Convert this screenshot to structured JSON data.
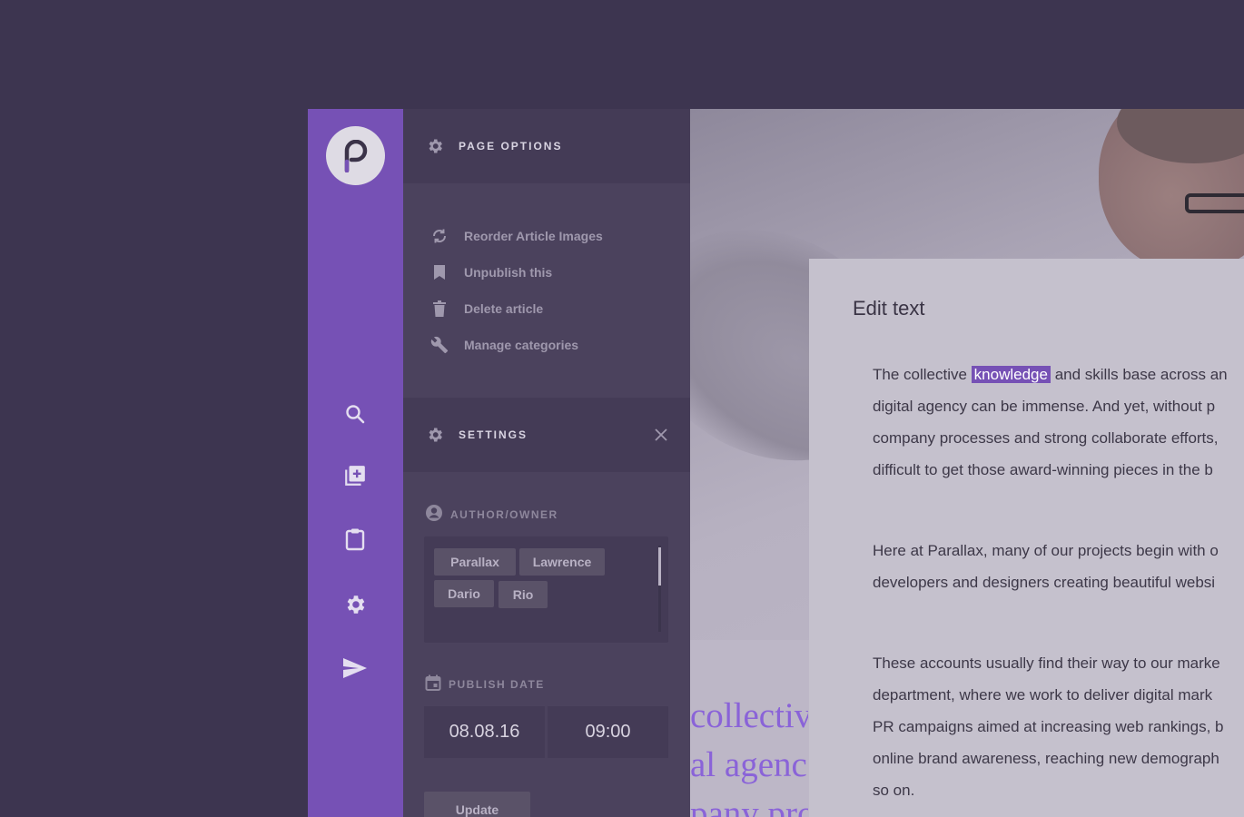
{
  "rail": {
    "logo_letter": "P",
    "icons": [
      "search-icon",
      "add-page-icon",
      "clipboard-icon",
      "gear-icon",
      "send-icon"
    ]
  },
  "page_options": {
    "title": "PAGE OPTIONS",
    "items": [
      {
        "icon": "reorder-icon",
        "label": "Reorder Article Images"
      },
      {
        "icon": "bookmark-icon",
        "label": "Unpublish this"
      },
      {
        "icon": "trash-icon",
        "label": "Delete article"
      },
      {
        "icon": "wrench-icon",
        "label": "Manage categories"
      }
    ]
  },
  "settings": {
    "title": "SETTINGS",
    "author_label": "AUTHOR/OWNER",
    "tags": [
      "Parallax",
      "Lawrence",
      "Dario",
      "Rio"
    ],
    "publish_label": "PUBLISH DATE",
    "date": "08.08.16",
    "time": "09:00",
    "update_label": "Update"
  },
  "hero": {
    "headline_lines": [
      "collectiv",
      "al agenc",
      "pany pro"
    ]
  },
  "editor": {
    "title": "Edit text",
    "paragraphs": [
      {
        "before": "The collective",
        "highlight": "knowledge",
        "after": "and skills base across an",
        "lines": [
          "digital agency can be immense. And yet, without p",
          "company processes and strong collaborate efforts,",
          "difficult to get those award-winning pieces in the b"
        ]
      },
      {
        "lines": [
          "Here at Parallax, many of our projects begin with o",
          "developers and designers creating beautiful websi"
        ]
      },
      {
        "lines": [
          "These accounts usually find their way to our marke",
          "department, where we work to deliver digital mark",
          "PR campaigns aimed at increasing web rankings, b",
          "online brand awareness, reaching new demograph",
          "so on."
        ]
      }
    ]
  },
  "colors": {
    "background": "#3d3550",
    "rail": "#7651b5",
    "highlight": "#7651b5"
  }
}
